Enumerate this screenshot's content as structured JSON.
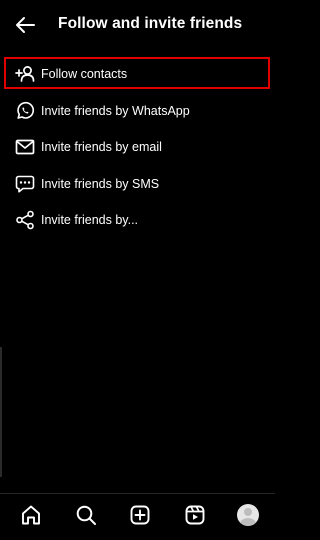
{
  "header": {
    "title": "Follow and invite friends",
    "back_icon": "arrow-left-icon"
  },
  "menu": {
    "items": [
      {
        "label": "Follow contacts",
        "icon": "add-person-icon",
        "highlighted": true
      },
      {
        "label": "Invite friends by WhatsApp",
        "icon": "whatsapp-icon",
        "highlighted": false
      },
      {
        "label": "Invite friends by email",
        "icon": "mail-icon",
        "highlighted": false
      },
      {
        "label": "Invite friends by SMS",
        "icon": "sms-icon",
        "highlighted": false
      },
      {
        "label": "Invite friends by...",
        "icon": "share-icon",
        "highlighted": false
      }
    ]
  },
  "bottom_nav": {
    "items": [
      {
        "icon": "home-icon"
      },
      {
        "icon": "search-icon"
      },
      {
        "icon": "create-icon"
      },
      {
        "icon": "reels-icon"
      },
      {
        "icon": "profile-avatar"
      }
    ]
  },
  "colors": {
    "background": "#000000",
    "text": "#ffffff",
    "highlight_border": "#e00000"
  }
}
